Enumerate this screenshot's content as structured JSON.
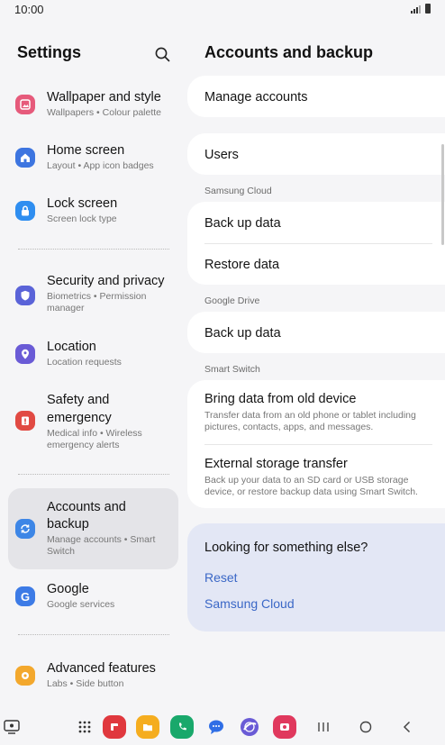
{
  "status_bar": {
    "time": "10:00"
  },
  "left": {
    "title": "Settings",
    "items": [
      {
        "label": "Wallpaper and style",
        "sub": "Wallpapers • Colour palette",
        "icon": "wallpaper-icon",
        "color": "#e65a7b"
      },
      {
        "label": "Home screen",
        "sub": "Layout • App icon badges",
        "icon": "home-icon",
        "color": "#3d75e0"
      },
      {
        "label": "Lock screen",
        "sub": "Screen lock type",
        "icon": "lock-icon",
        "color": "#2f8ef0"
      },
      {
        "label": "Security and privacy",
        "sub": "Biometrics • Permission manager",
        "icon": "shield-icon",
        "color": "#5a63d8"
      },
      {
        "label": "Location",
        "sub": "Location requests",
        "icon": "location-pin-icon",
        "color": "#6a5bd6"
      },
      {
        "label": "Safety and emergency",
        "sub": "Medical info • Wireless emergency alerts",
        "icon": "emergency-icon",
        "color": "#e14a43"
      },
      {
        "label": "Accounts and backup",
        "sub": "Manage accounts • Smart Switch",
        "icon": "sync-icon",
        "color": "#3d86e6"
      },
      {
        "label": "Google",
        "sub": "Google services",
        "icon": "google-icon",
        "color": "#3d7be6"
      },
      {
        "label": "Advanced features",
        "sub": "Labs • Side button",
        "icon": "gear-icon",
        "color": "#f3a82d"
      }
    ]
  },
  "right": {
    "title": "Accounts and backup",
    "manage_accounts": "Manage accounts",
    "users": "Users",
    "samsung_cloud_header": "Samsung Cloud",
    "sc_backup": "Back up data",
    "sc_restore": "Restore data",
    "google_drive_header": "Google Drive",
    "gd_backup": "Back up data",
    "smart_switch_header": "Smart Switch",
    "bring_data_label": "Bring data from old device",
    "bring_data_sub": "Transfer data from an old phone or tablet including pictures, contacts, apps, and messages.",
    "external_label": "External storage transfer",
    "external_sub": "Back up your data to an SD card or USB storage device, or restore backup data using Smart Switch.",
    "suggest_title": "Looking for something else?",
    "suggest_reset": "Reset",
    "suggest_samsung_cloud": "Samsung Cloud"
  },
  "navbar": {
    "apps": [
      {
        "name": "flipboard-icon",
        "color": "#e0383e"
      },
      {
        "name": "my-files-icon",
        "color": "#f5ad1f"
      },
      {
        "name": "phone-icon",
        "color": "#19a86b"
      },
      {
        "name": "messages-icon",
        "color": "#2f6ee6"
      },
      {
        "name": "internet-icon",
        "color": "#6a5bd6"
      },
      {
        "name": "screen-recorder-icon",
        "color": "#e0385d"
      }
    ]
  }
}
